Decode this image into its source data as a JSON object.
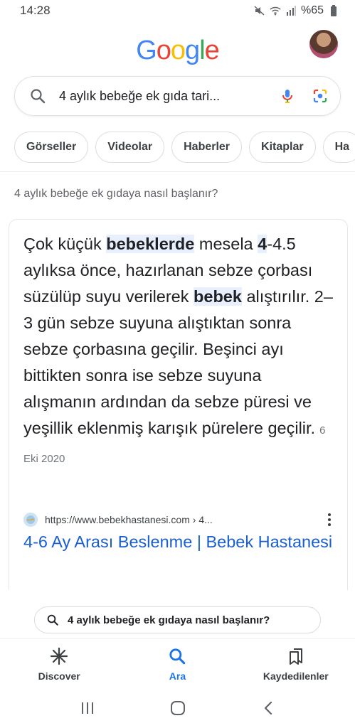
{
  "status": {
    "time": "14:28",
    "battery": "%65"
  },
  "logo": {
    "letters": [
      "G",
      "o",
      "o",
      "g",
      "l",
      "e"
    ],
    "colors": [
      "#4285f4",
      "#ea4335",
      "#fbbc05",
      "#4285f4",
      "#34a853",
      "#ea4335"
    ]
  },
  "search": {
    "query": "4 aylık bebeğe ek gıda tari..."
  },
  "chips": [
    "Görseller",
    "Videolar",
    "Haberler",
    "Kitaplar",
    "Ha"
  ],
  "question": "4 aylık bebeğe ek gıdaya nasıl başlanır?",
  "snippet": {
    "p1": "Çok küçük ",
    "h1": "bebeklerde",
    "p2": " mesela ",
    "h2": "4",
    "p3": "-4.5 aylıksa önce, hazırlanan sebze çorbası süzülüp suyu verilerek ",
    "h3": "bebek",
    "p4": " alıştırılır. 2–3 gün sebze suyuna alıştıktan sonra sebze çorbasına geçilir. Beşinci ayı bittikten sonra ise sebze suyuna alışmanın ardından da sebze püresi ve yeşillik eklenmiş karışık pürelere geçilir.",
    "date": "6 Eki 2020"
  },
  "result": {
    "url": "https://www.bebekhastanesi.com › 4...",
    "title": "4-6 Ay Arası Beslenme | Bebek Hastanesi"
  },
  "related": {
    "query": "4 aylık bebeğe ek gıdaya nasıl başlanır?"
  },
  "bottom_nav": {
    "discover": "Discover",
    "search": "Ara",
    "saved": "Kaydedilenler",
    "active": "Ara"
  },
  "colors": {
    "link_blue": "#1a5fcf",
    "active_blue": "#1a73e8",
    "highlight_bg": "#e8f0fe"
  }
}
